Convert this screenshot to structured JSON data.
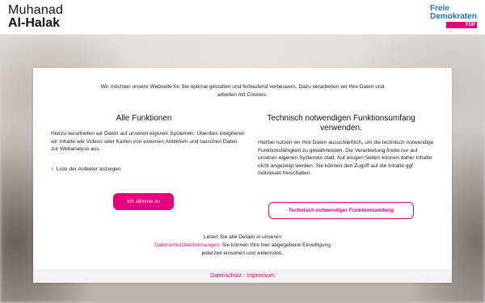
{
  "header": {
    "name_first": "Muhanad",
    "name_last": "Al-Halak",
    "party_line1": "Freie",
    "party_line2": "Demokraten",
    "party_abbr": "FDP"
  },
  "consent": {
    "intro": "Wir möchten unsere Webseite für Sie optimal gestalten und fortlaufend verbessern. Dazu verarbeiten wir Ihre Daten und arbeiten mit Cookies.",
    "left": {
      "title": "Alle Funktionen",
      "text": "Hierzu verarbeiten wir Daten auf unseren eigenen Systemen. Überdies integrieren wir Inhalte wie Videos oder Karten von externen Anbietern und tauschen Daten zur Webanalyse aus.",
      "provider_link": "Liste der Anbieter anzeigen",
      "button": "Ich stimme zu"
    },
    "right": {
      "title": "Technisch notwendigen Funktionsumfang verwenden.",
      "text": "Hierbei nutzen wir Ihre Daten ausschließlich, um die technisch notwendige Funktionsfähigkeit zu gewährleisten. Die Verarbeitung findet nur auf unseren eigenen Systemen statt. Auf einigen Seiten können daher Inhalte nicht angezeigt werden. Sie können den Zugriff auf die Inhalte ggf. individuell freischalten.",
      "button": "Technisch notwendiger Funktionsumfang"
    },
    "details_before": "Lesen Sie alle Details in unseren",
    "details_link": "Datenschutzbestimmungen",
    "details_after": ". Sie können Ihre hier abgegebene Einwilligung jederzeit einsehen und widerrufen.",
    "footer_privacy": "Datenschutz",
    "footer_sep": " - ",
    "footer_imprint": "Impressum"
  },
  "colors": {
    "accent": "#e5007d",
    "party_blue": "#1b74c9"
  }
}
